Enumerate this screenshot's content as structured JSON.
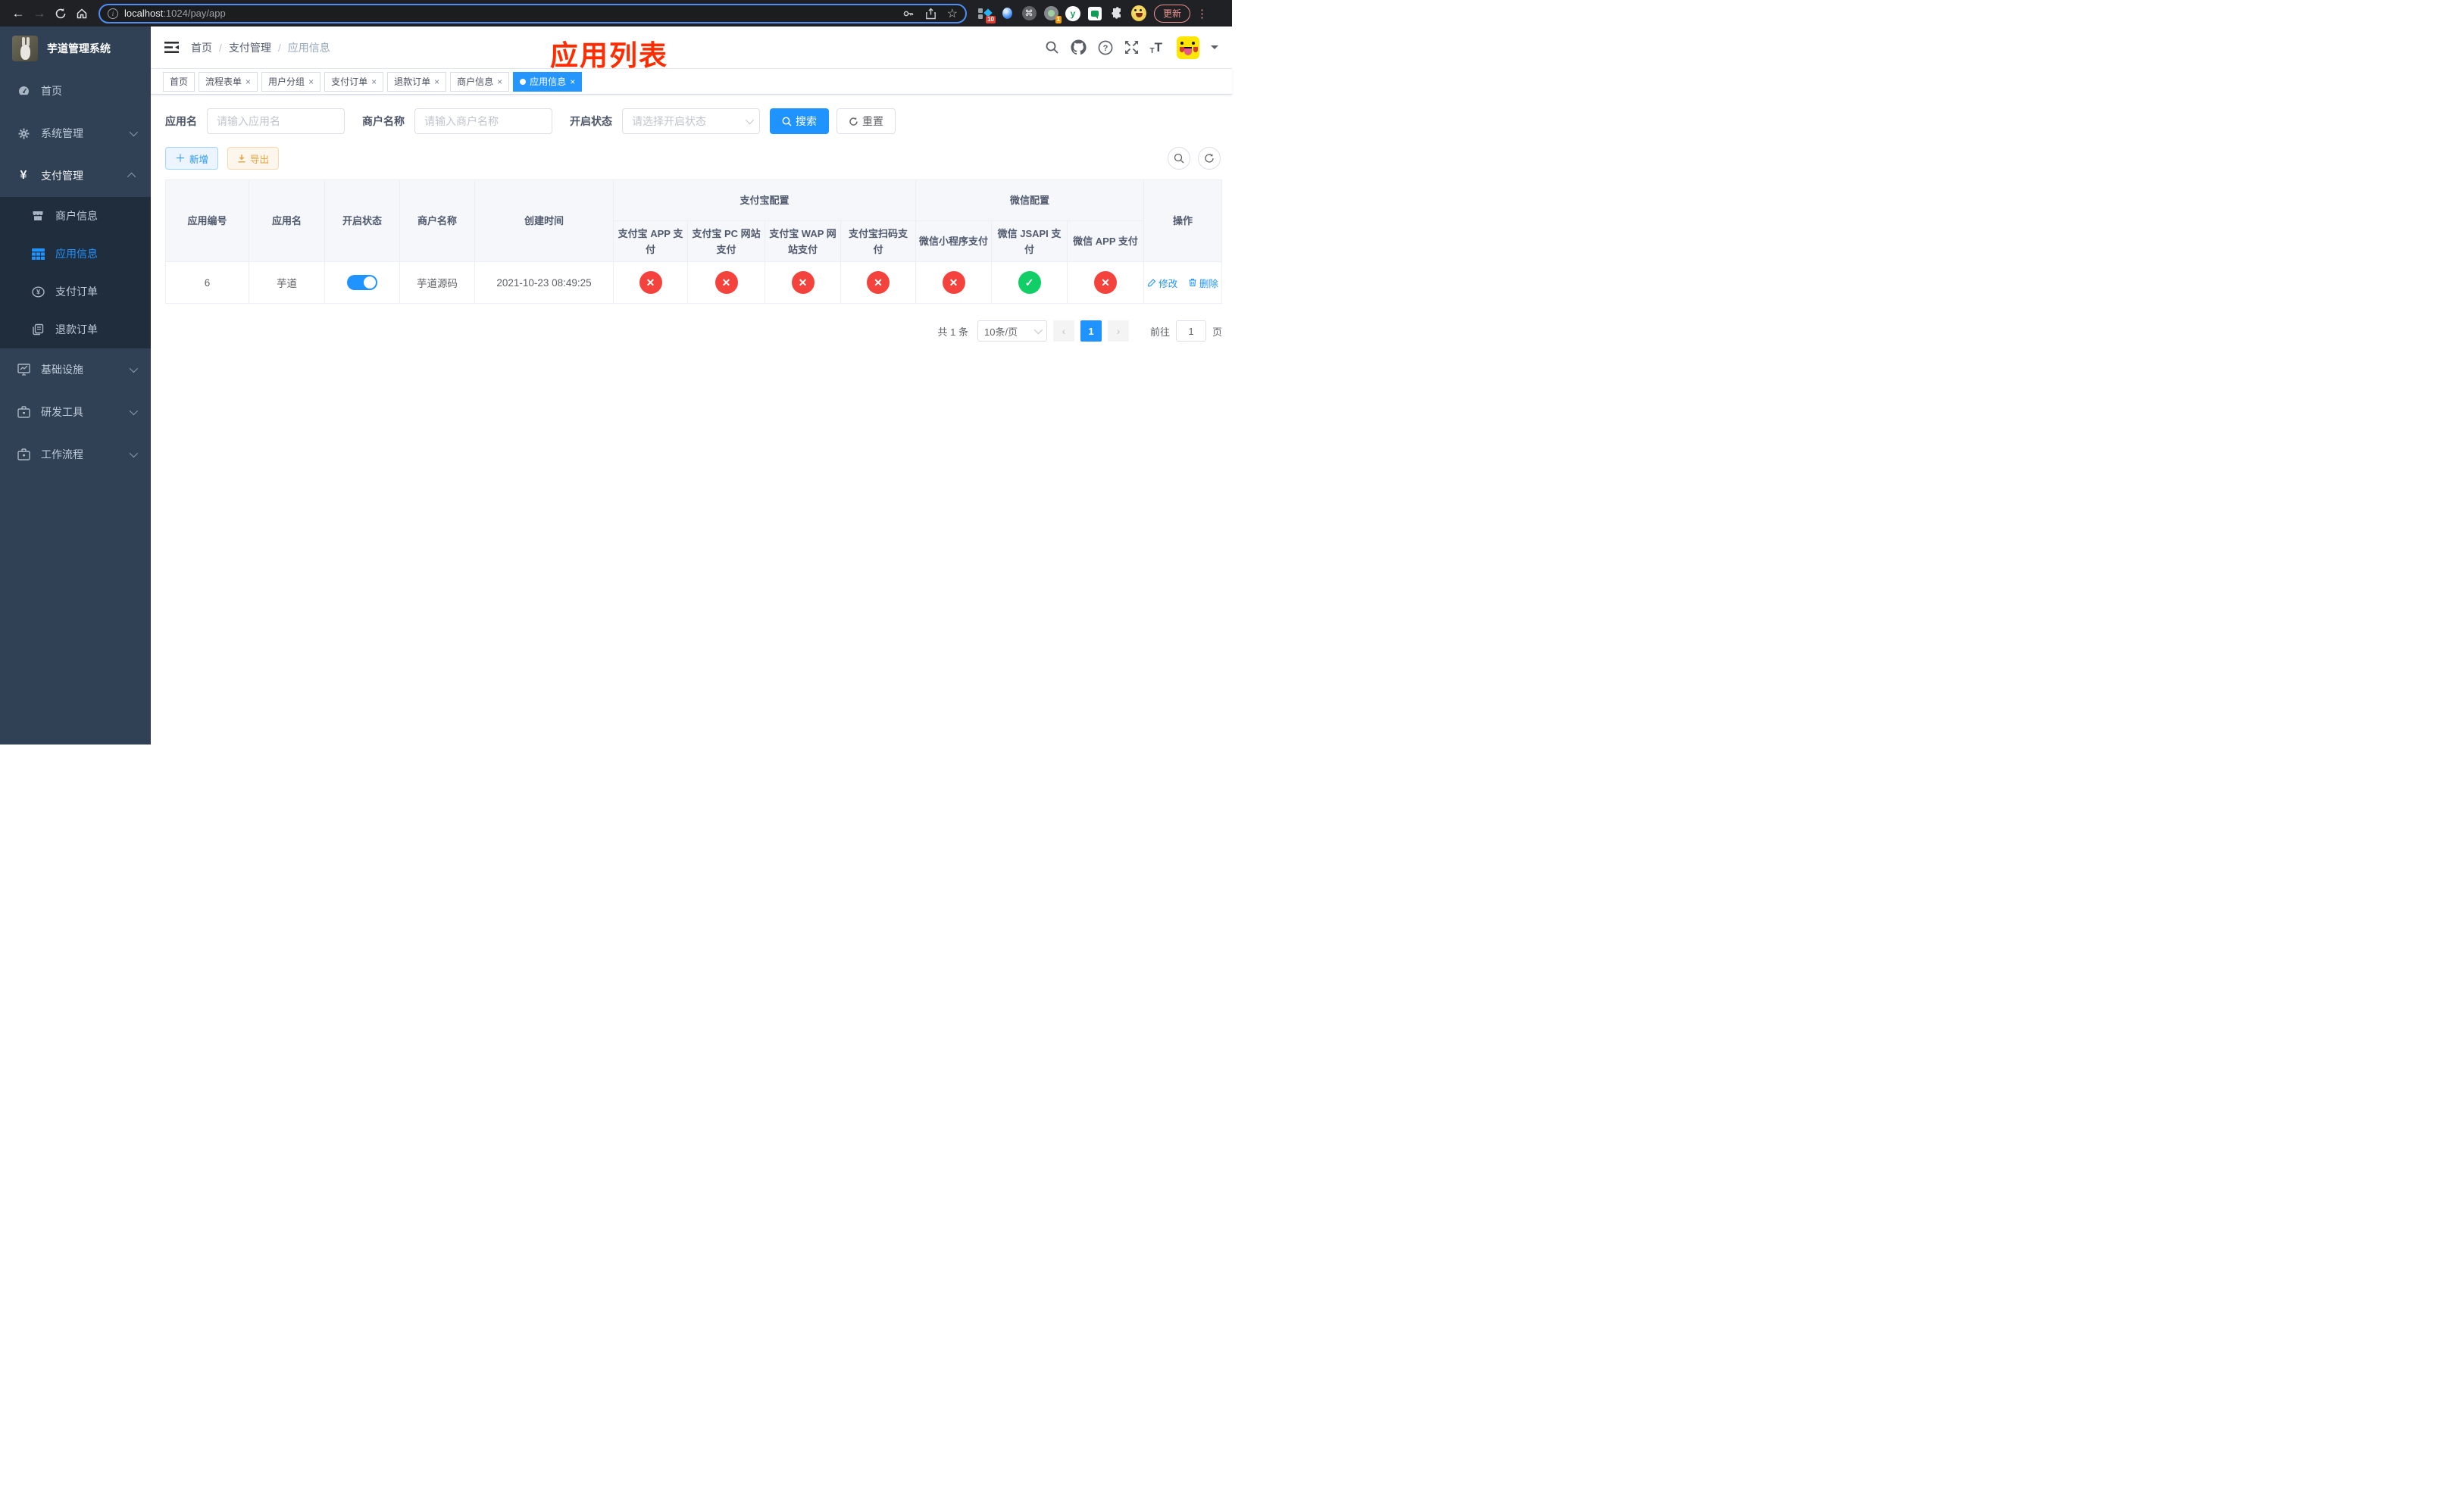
{
  "colors": {
    "primary": "#1f93ff",
    "danger": "#f4433c",
    "success": "#12ce66",
    "warning": "#e6a23c",
    "title_red": "#fe2c00",
    "sidebar_bg": "#304156",
    "submenu_bg": "#1f2d3d"
  },
  "browser": {
    "url_host": "localhost",
    "url_path": ":1024/pay/app",
    "ext_badge_10": "10",
    "ext_badge_1": "1",
    "update_button": "更新"
  },
  "sidebar": {
    "title": "芋道管理系统",
    "items": [
      {
        "label": "首页"
      },
      {
        "label": "系统管理"
      },
      {
        "label": "支付管理"
      },
      {
        "label": "商户信息"
      },
      {
        "label": "应用信息"
      },
      {
        "label": "支付订单"
      },
      {
        "label": "退款订单"
      },
      {
        "label": "基础设施"
      },
      {
        "label": "研发工具"
      },
      {
        "label": "工作流程"
      }
    ]
  },
  "breadcrumb": {
    "home": "首页",
    "section": "支付管理",
    "current": "应用信息"
  },
  "page_title": "应用列表",
  "tabs": [
    {
      "label": "首页"
    },
    {
      "label": "流程表单"
    },
    {
      "label": "用户分组"
    },
    {
      "label": "支付订单"
    },
    {
      "label": "退款订单"
    },
    {
      "label": "商户信息"
    },
    {
      "label": "应用信息"
    }
  ],
  "filters": {
    "app_name_label": "应用名",
    "app_name_placeholder": "请输入应用名",
    "merchant_label": "商户名称",
    "merchant_placeholder": "请输入商户名称",
    "status_label": "开启状态",
    "status_placeholder": "请选择开启状态",
    "search_button": "搜索",
    "reset_button": "重置"
  },
  "toolbar": {
    "add_button": "新增",
    "export_button": "导出"
  },
  "table": {
    "col_app_id": "应用编号",
    "col_app_name": "应用名",
    "col_status": "开启状态",
    "col_merchant": "商户名称",
    "col_created": "创建时间",
    "group_alipay": "支付宝配置",
    "group_wechat": "微信配置",
    "col_alipay_app": "支付宝 APP 支付",
    "col_alipay_pc": "支付宝 PC 网站支付",
    "col_alipay_wap": "支付宝 WAP 网站支付",
    "col_alipay_qr": "支付宝扫码支付",
    "col_wx_lite": "微信小程序支付",
    "col_wx_jsapi": "微信 JSAPI 支付",
    "col_wx_app": "微信 APP 支付",
    "col_op": "操作",
    "edit_link": "修改",
    "delete_link": "删除",
    "rows": [
      {
        "app_id": "6",
        "app_name": "芋道",
        "enabled": true,
        "merchant": "芋道源码",
        "created": "2021-10-23 08:49:25",
        "statuses": [
          false,
          false,
          false,
          false,
          false,
          true,
          false
        ]
      }
    ]
  },
  "pagination": {
    "total": "共 1 条",
    "page_size": "10条/页",
    "page": "1",
    "goto_label": "前往",
    "goto_value": "1",
    "page_suffix": "页"
  }
}
